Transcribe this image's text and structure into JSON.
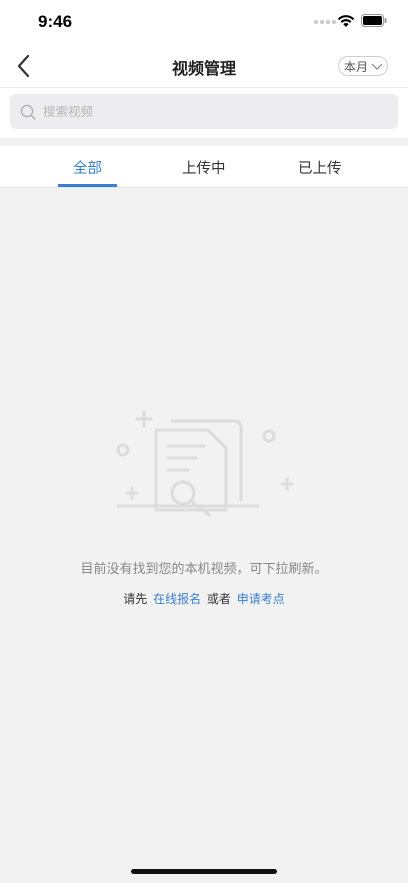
{
  "status_bar": {
    "time": "9:46"
  },
  "nav": {
    "title": "视频管理",
    "period": "本月"
  },
  "search": {
    "placeholder": "搜索视频",
    "value": ""
  },
  "tabs": [
    {
      "label": "全部",
      "active": true
    },
    {
      "label": "上传中",
      "active": false
    },
    {
      "label": "已上传",
      "active": false
    }
  ],
  "empty_state": {
    "message": "目前没有找到您的本机视频，可下拉刷新。",
    "prefix": "请先",
    "link_register": "在线报名",
    "connector": "或者",
    "link_apply": "申请考点"
  },
  "colors": {
    "accent": "#3a7fd0",
    "background": "#f2f2f2",
    "illustration": "#dcdcdc"
  },
  "icons": [
    "wifi-icon",
    "battery-icon",
    "back-arrow-icon",
    "chevron-down-icon",
    "search-icon",
    "document-search-icon"
  ]
}
